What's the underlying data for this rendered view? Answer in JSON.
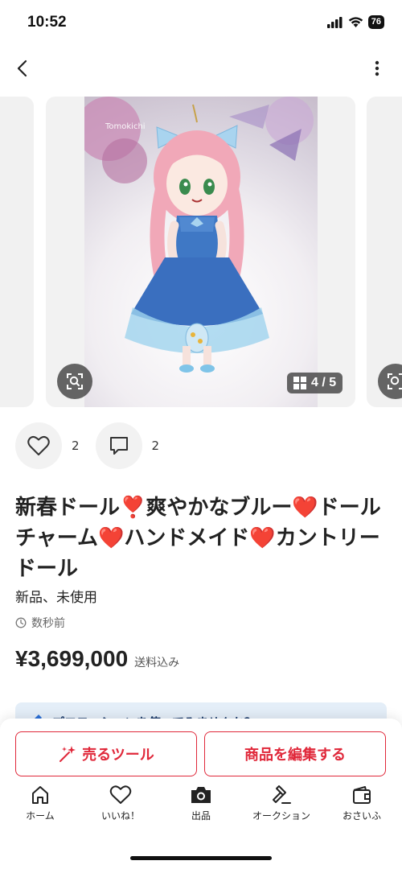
{
  "status": {
    "time": "10:52",
    "battery": "76"
  },
  "carousel": {
    "watermark": "Tomokichi",
    "prev_counter": "/ 5",
    "counter": "4 / 5"
  },
  "reactions": {
    "like_count": "2",
    "comment_count": "2"
  },
  "product": {
    "title_parts": [
      "新春ドール",
      "❣️",
      "爽やかなブルー",
      "❤️",
      "ドールチャーム",
      "❤️",
      "ハンドメイド",
      "❤️",
      "カントリードール"
    ],
    "condition": "新品、未使用",
    "posted": "数秒前",
    "price": "¥3,699,000",
    "shipping": "送料込み"
  },
  "promo": {
    "text": "プロモーションを使ってみませんか？"
  },
  "actions": {
    "sell_tool": "売るツール",
    "edit": "商品を編集する"
  },
  "tabbar": {
    "items": [
      {
        "label": "ホーム",
        "icon": "home-icon"
      },
      {
        "label": "いいね！",
        "icon": "heart-icon"
      },
      {
        "label": "出品",
        "icon": "camera-icon"
      },
      {
        "label": "オークション",
        "icon": "gavel-icon"
      },
      {
        "label": "おさいふ",
        "icon": "wallet-icon"
      }
    ]
  },
  "colors": {
    "accent": "#e0283a",
    "heart": "#e02a2a",
    "promo_bg": "#e4eef8"
  }
}
